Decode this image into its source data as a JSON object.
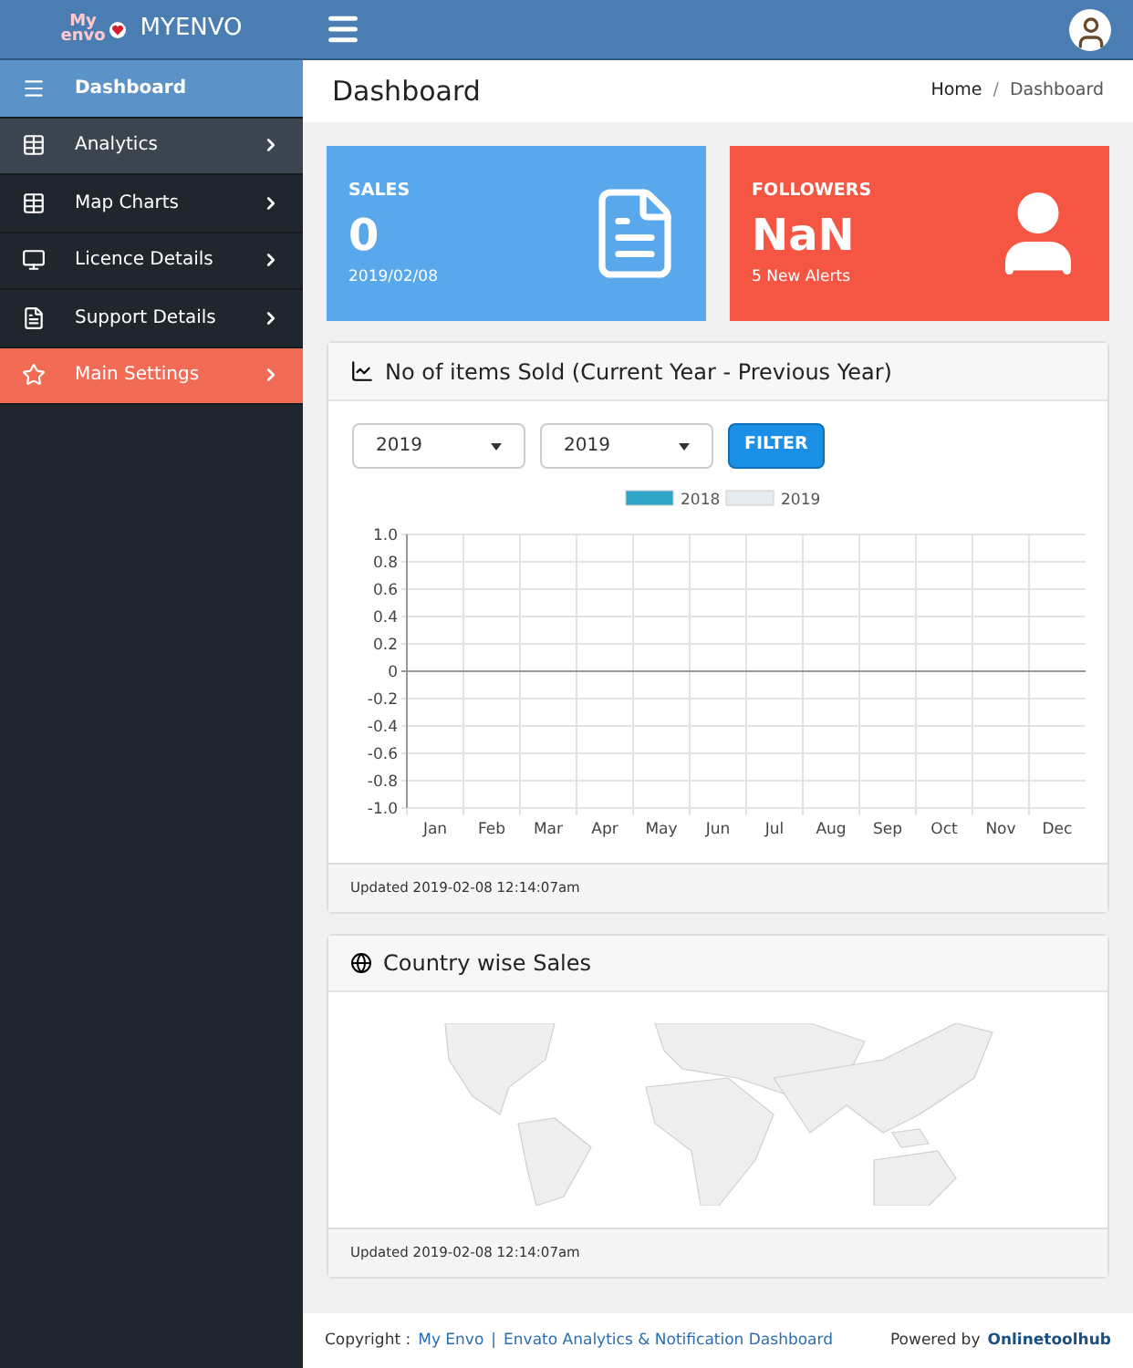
{
  "header": {
    "logo_small_top": "My",
    "logo_small_bottom": "envo",
    "brand": "MYENVO"
  },
  "sidebar": {
    "items": [
      {
        "label": "Dashboard",
        "selected": true,
        "submenu": false,
        "color": "#5b93c9"
      },
      {
        "label": "Analytics",
        "selected": false,
        "submenu": true,
        "color": "#3b4550"
      },
      {
        "label": "Map Charts",
        "selected": false,
        "submenu": true,
        "color": "#1f262d"
      },
      {
        "label": "Licence Details",
        "selected": false,
        "submenu": true,
        "color": "#1f262d"
      },
      {
        "label": "Support Details",
        "selected": false,
        "submenu": true,
        "color": "#1f262d"
      },
      {
        "label": "Main Settings",
        "selected": false,
        "submenu": true,
        "color": "#f26b55"
      }
    ]
  },
  "page": {
    "title": "Dashboard",
    "breadcrumb": [
      "Home",
      "Dashboard"
    ],
    "breadcrumb_separator": "/"
  },
  "stats": [
    {
      "kind": "document",
      "title": "SALES",
      "value": "0",
      "caption": "2019/02/08",
      "color": "#5aa8ec"
    },
    {
      "kind": "person",
      "title": "FOLLOWERS",
      "value": "NaN",
      "caption": "5 New Alerts",
      "color": "#f55543"
    }
  ],
  "sales_panel": {
    "title": "No of items Sold (Current Year - Previous Year)",
    "selects": [
      "2019",
      "2019"
    ],
    "button": "FILTER",
    "updated": "Updated 2019-02-08 12:14:07am",
    "chart_data": {
      "type": "bar",
      "categories": [
        "Jan",
        "Feb",
        "Mar",
        "Apr",
        "May",
        "Jun",
        "Jul",
        "Aug",
        "Sep",
        "Oct",
        "Nov",
        "Dec"
      ],
      "series": [
        {
          "name": "2018",
          "color": "#2fa6c8",
          "values": [
            null,
            null,
            null,
            null,
            null,
            null,
            null,
            null,
            null,
            null,
            null,
            null
          ]
        },
        {
          "name": "2019",
          "color": "#e6ebf1",
          "values": [
            null,
            null,
            null,
            null,
            null,
            null,
            null,
            null,
            null,
            null,
            null,
            null
          ]
        }
      ],
      "grid": true,
      "ylim": [
        -1,
        1
      ],
      "yticks": [
        {
          "value": 1,
          "label": "1.0"
        },
        {
          "value": 0.8,
          "label": "0.8"
        },
        {
          "value": 0.6,
          "label": "0.6"
        },
        {
          "value": 0.4,
          "label": "0.4"
        },
        {
          "value": 0.2,
          "label": "0.2"
        },
        {
          "value": 0,
          "label": "0"
        },
        {
          "value": -0.2,
          "label": "-0.2"
        },
        {
          "value": -0.4,
          "label": "-0.4"
        },
        {
          "value": -0.6,
          "label": "-0.6"
        },
        {
          "value": -0.8,
          "label": "-0.8"
        },
        {
          "value": -1,
          "label": "-1.0"
        }
      ]
    }
  },
  "map_panel": {
    "title": "Country wise Sales",
    "updated": "Updated 2019-02-08 12:14:07am"
  },
  "footer": {
    "copyright_label": "Copyright :",
    "link1": "My Envo",
    "separator": "|",
    "link2": "Envato Analytics & Notification Dashboard",
    "powered_label": "Powered by",
    "powered_link": "Onlinetoolhub"
  }
}
